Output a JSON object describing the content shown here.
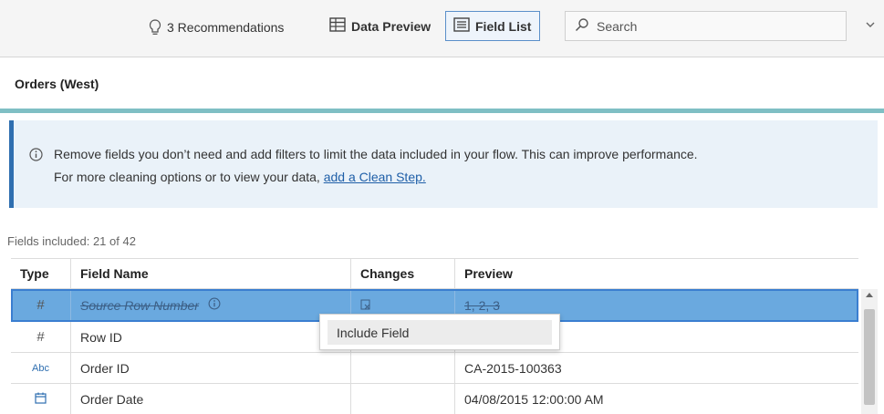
{
  "toolbar": {
    "recommendations_label": "3 Recommendations",
    "data_preview_label": "Data Preview",
    "field_list_label": "Field List",
    "search_placeholder": "Search"
  },
  "title": "Orders (West)",
  "banner": {
    "line1": "Remove fields you don’t need and add filters to limit the data included in your flow. This can improve performance.",
    "line2_prefix": "For more cleaning options or to view your data, ",
    "link_text": "add a Clean Step."
  },
  "fields_count": "Fields included: 21 of 42",
  "table": {
    "headers": [
      "Type",
      "Field Name",
      "Changes",
      "Preview"
    ],
    "rows": [
      {
        "type_icon": "#",
        "name": "Source Row Number",
        "preview": "1, 2, 3"
      },
      {
        "type_icon": "#",
        "name": "Row ID",
        "preview": ""
      },
      {
        "type_icon": "Abc",
        "name": "Order ID",
        "preview": "CA-2015-100363"
      },
      {
        "type_icon": "date-icon",
        "name": "Order Date",
        "preview": "04/08/2015 12:00:00 AM"
      }
    ]
  },
  "context_menu": {
    "items": [
      "Include Field"
    ]
  },
  "colors": {
    "accent": "#7fbfc4",
    "selected_row": "#6aa9df",
    "banner_bg": "#eaf2f9",
    "link": "#1f5fa8"
  }
}
